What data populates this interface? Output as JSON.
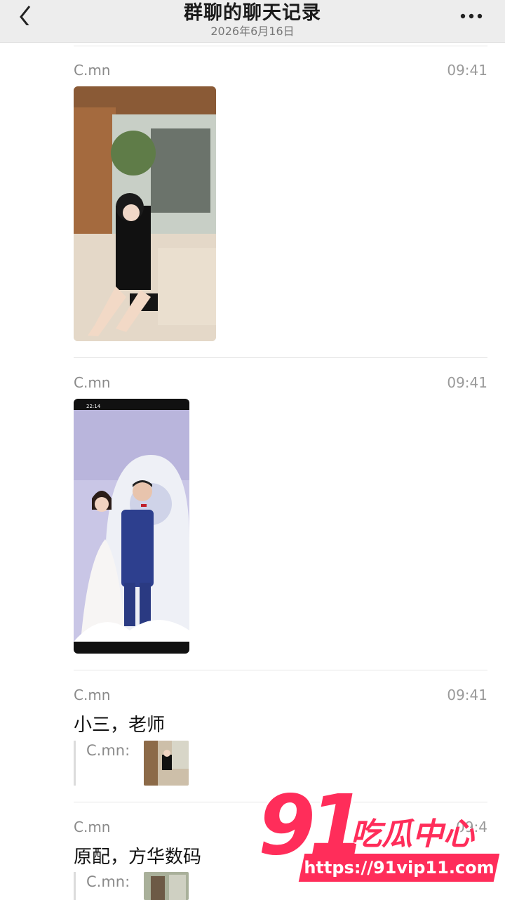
{
  "header": {
    "title": "群聊的聊天记录",
    "date": "2026年6月16日"
  },
  "messages": [
    {
      "sender": "C.mn",
      "time": "09:41",
      "type": "image"
    },
    {
      "sender": "C.mn",
      "time": "09:41",
      "type": "image"
    },
    {
      "sender": "C.mn",
      "time": "09:41",
      "text": "小三，老师",
      "quote": {
        "name": "C.mn:"
      }
    },
    {
      "sender": "C.mn",
      "time": "09:4",
      "text": "原配，方华数码",
      "quote": {
        "name": "C.mn:"
      }
    }
  ],
  "phone_status": {
    "time": "22:14"
  },
  "watermark": {
    "number": "91",
    "label": "吃瓜中心",
    "url": "https://91vip11.com"
  },
  "icons": [
    "back-icon",
    "more-icon"
  ],
  "colors": {
    "header_bg": "#ededed",
    "watermark": "#ff2d5a"
  }
}
